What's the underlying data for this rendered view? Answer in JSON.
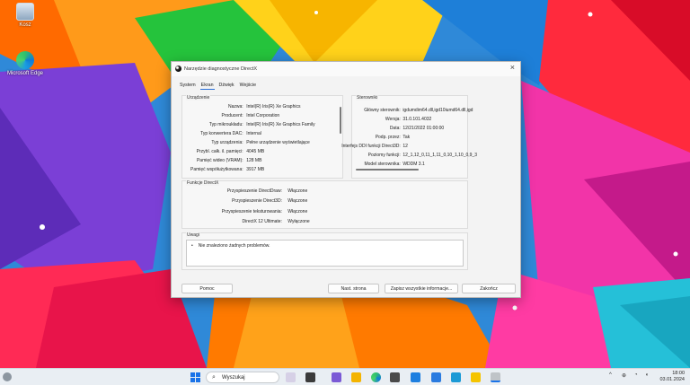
{
  "desktop": {
    "icons": [
      {
        "label": "Kosz"
      },
      {
        "label": "Microsoft Edge"
      }
    ]
  },
  "window": {
    "title": "Narzędzie diagnostyczne DirectX",
    "tabs": [
      {
        "label": "System"
      },
      {
        "label": "Ekran"
      },
      {
        "label": "Dźwięk"
      },
      {
        "label": "Wejście"
      }
    ],
    "device": {
      "title": "Urządzenie",
      "rows": [
        {
          "key": "Nazwa:",
          "value": "Intel(R) Iris(R) Xe Graphics"
        },
        {
          "key": "Producent:",
          "value": "Intel Corporation"
        },
        {
          "key": "Typ mikroukładu:",
          "value": "Intel(R) Iris(R) Xe Graphics Family"
        },
        {
          "key": "Typ konwertera DAC:",
          "value": "Internal"
        },
        {
          "key": "Typ urządzenia:",
          "value": "Pełne urządzenie wyświetlające"
        },
        {
          "key": "Przybl. całk. il. pamięci:",
          "value": "4045 MB"
        },
        {
          "key": "Pamięć wideo (VRAM):",
          "value": "128 MB"
        },
        {
          "key": "Pamięć współużytkowana:",
          "value": "3917 MB"
        }
      ]
    },
    "driver": {
      "title": "Sterowniki",
      "rows": [
        {
          "key": "Główny sterownik:",
          "value": "igdumdim64.dll,igd10iumd64.dll,igd"
        },
        {
          "key": "Wersja:",
          "value": "31.0.101.4032"
        },
        {
          "key": "Data:",
          "value": "12/21/2022 01:00:00"
        },
        {
          "key": "Podp. przez:",
          "value": "Tak"
        },
        {
          "key": "Interfejs DDI funkcji Direct3D:",
          "value": "12"
        },
        {
          "key": "Poziomy funkcji:",
          "value": "12_1,12_0,11_1,11_0,10_1,10_0,9_3"
        },
        {
          "key": "Model sterownika:",
          "value": "WDDM 3.1"
        }
      ]
    },
    "directx": {
      "title": "Funkcje DirectX",
      "rows": [
        {
          "key": "Przyspieszenie DirectDraw:",
          "value": "Włączone"
        },
        {
          "key": "Przyspieszenie Direct3D:",
          "value": "Włączone"
        },
        {
          "key": "Przyspieszenie teksturowania:",
          "value": "Włączone"
        },
        {
          "key": "DirectX 12 Ultimate:",
          "value": "Wyłączone"
        }
      ]
    },
    "notes": {
      "title": "Uwagi",
      "bullet": "•",
      "text": "Nie znaleziono żadnych problemów."
    },
    "buttons": {
      "help": "Pomoc",
      "next": "Nast. strona",
      "save": "Zapisz wszystkie informacje...",
      "exit": "Zakończ"
    }
  },
  "taskbar": {
    "search_placeholder": "Wyszukaj",
    "time": "18:00",
    "date": "03.01.2024",
    "tray_chevron": "^"
  },
  "colors": {
    "accent": "#1a73e8",
    "window_bg": "#f3f3f3",
    "taskbar_bg": "#e9eef3"
  }
}
